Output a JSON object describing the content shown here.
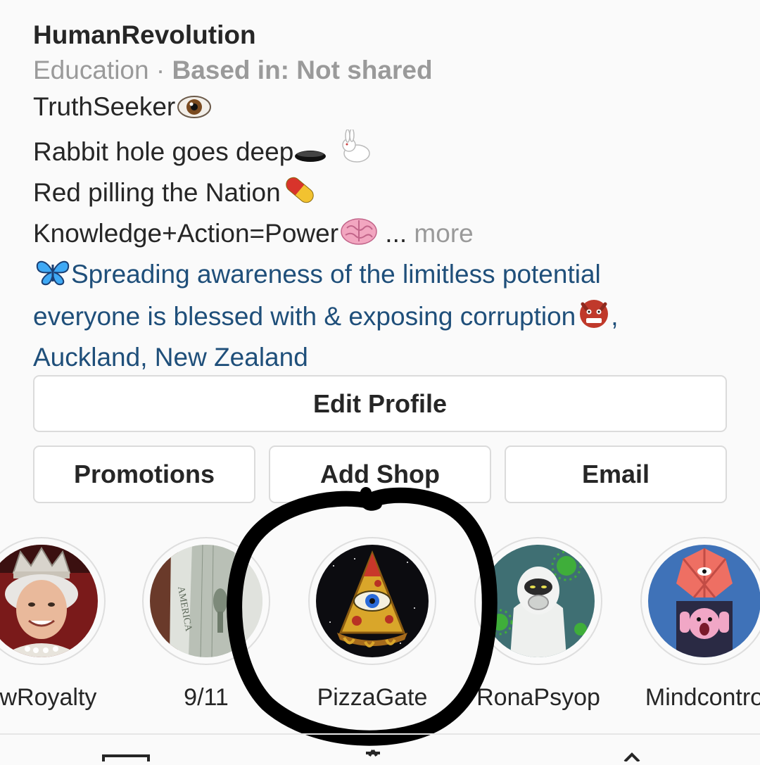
{
  "profile": {
    "username": "HumanRevolution",
    "category": "Education",
    "separator": "·",
    "based_in": "Based in: Not shared",
    "bio": [
      {
        "text": "TruthSeeker",
        "emoji": "eye-icon"
      },
      {
        "text": "Rabbit hole goes deep",
        "emoji": "hole-rabbit-icon"
      },
      {
        "text": "Red pilling the Nation",
        "emoji": "pill-icon"
      },
      {
        "text": "Knowledge+Action=Power",
        "emoji": "brain-icon",
        "ellipsis": "...",
        "more": "more"
      }
    ],
    "link_lines": [
      "Spreading awareness of the limitless potential",
      "everyone is blessed with & exposing corruption",
      "Auckland, New Zealand"
    ],
    "link_emoji_start": "butterfly-icon",
    "link_emoji_end": "ogre-icon",
    "link_trailing": ","
  },
  "buttons": {
    "edit_profile": "Edit Profile",
    "promotions": "Promotions",
    "add_shop": "Add Shop",
    "email": "Email"
  },
  "highlights": [
    {
      "label": "ewRoyalty",
      "icon": "queen-portrait"
    },
    {
      "label": "9/11",
      "icon": "dollar-bill"
    },
    {
      "label": "PizzaGate",
      "icon": "pizza-eye"
    },
    {
      "label": "RonaPsyop",
      "icon": "hazmat-virus"
    },
    {
      "label": "Mindcontro",
      "icon": "pink-eye-figure"
    }
  ],
  "colors": {
    "link": "#1f4f7a",
    "muted": "#9a9a9a",
    "text": "#262626",
    "border": "#dbdbdb",
    "marker": "#000000"
  }
}
